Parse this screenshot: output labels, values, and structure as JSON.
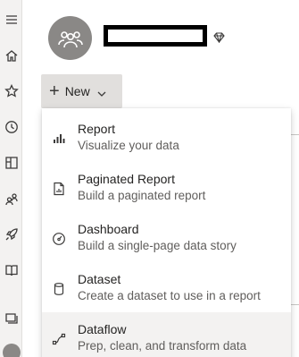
{
  "workspace": {
    "name": "",
    "avatar_icon": "people-group-icon",
    "badge_icon": "diamond-icon"
  },
  "nav": {
    "items": [
      {
        "name": "menu-icon"
      },
      {
        "name": "home-icon"
      },
      {
        "name": "star-icon"
      },
      {
        "name": "clock-icon"
      },
      {
        "name": "apps-icon"
      },
      {
        "name": "shared-icon"
      },
      {
        "name": "rocket-icon"
      },
      {
        "name": "book-icon"
      },
      {
        "name": "workspaces-icon"
      }
    ]
  },
  "toolbar": {
    "new_label": "New"
  },
  "new_menu": {
    "items": [
      {
        "title": "Report",
        "description": "Visualize your data",
        "icon": "bar-chart-icon"
      },
      {
        "title": "Paginated Report",
        "description": "Build a paginated report",
        "icon": "paginated-report-icon"
      },
      {
        "title": "Dashboard",
        "description": "Build a single-page data story",
        "icon": "gauge-icon"
      },
      {
        "title": "Dataset",
        "description": "Create a dataset to use in a report",
        "icon": "database-icon"
      },
      {
        "title": "Dataflow",
        "description": "Prep, clean, and transform data",
        "icon": "dataflow-icon",
        "active": true
      }
    ]
  },
  "colors": {
    "nav_bg": "#f3f2f1",
    "avatar_bg": "#8a8886",
    "button_bg": "#e1dfdd",
    "hover_bg": "#f3f2f1",
    "text": "#252423",
    "subtext": "#605e5c"
  }
}
